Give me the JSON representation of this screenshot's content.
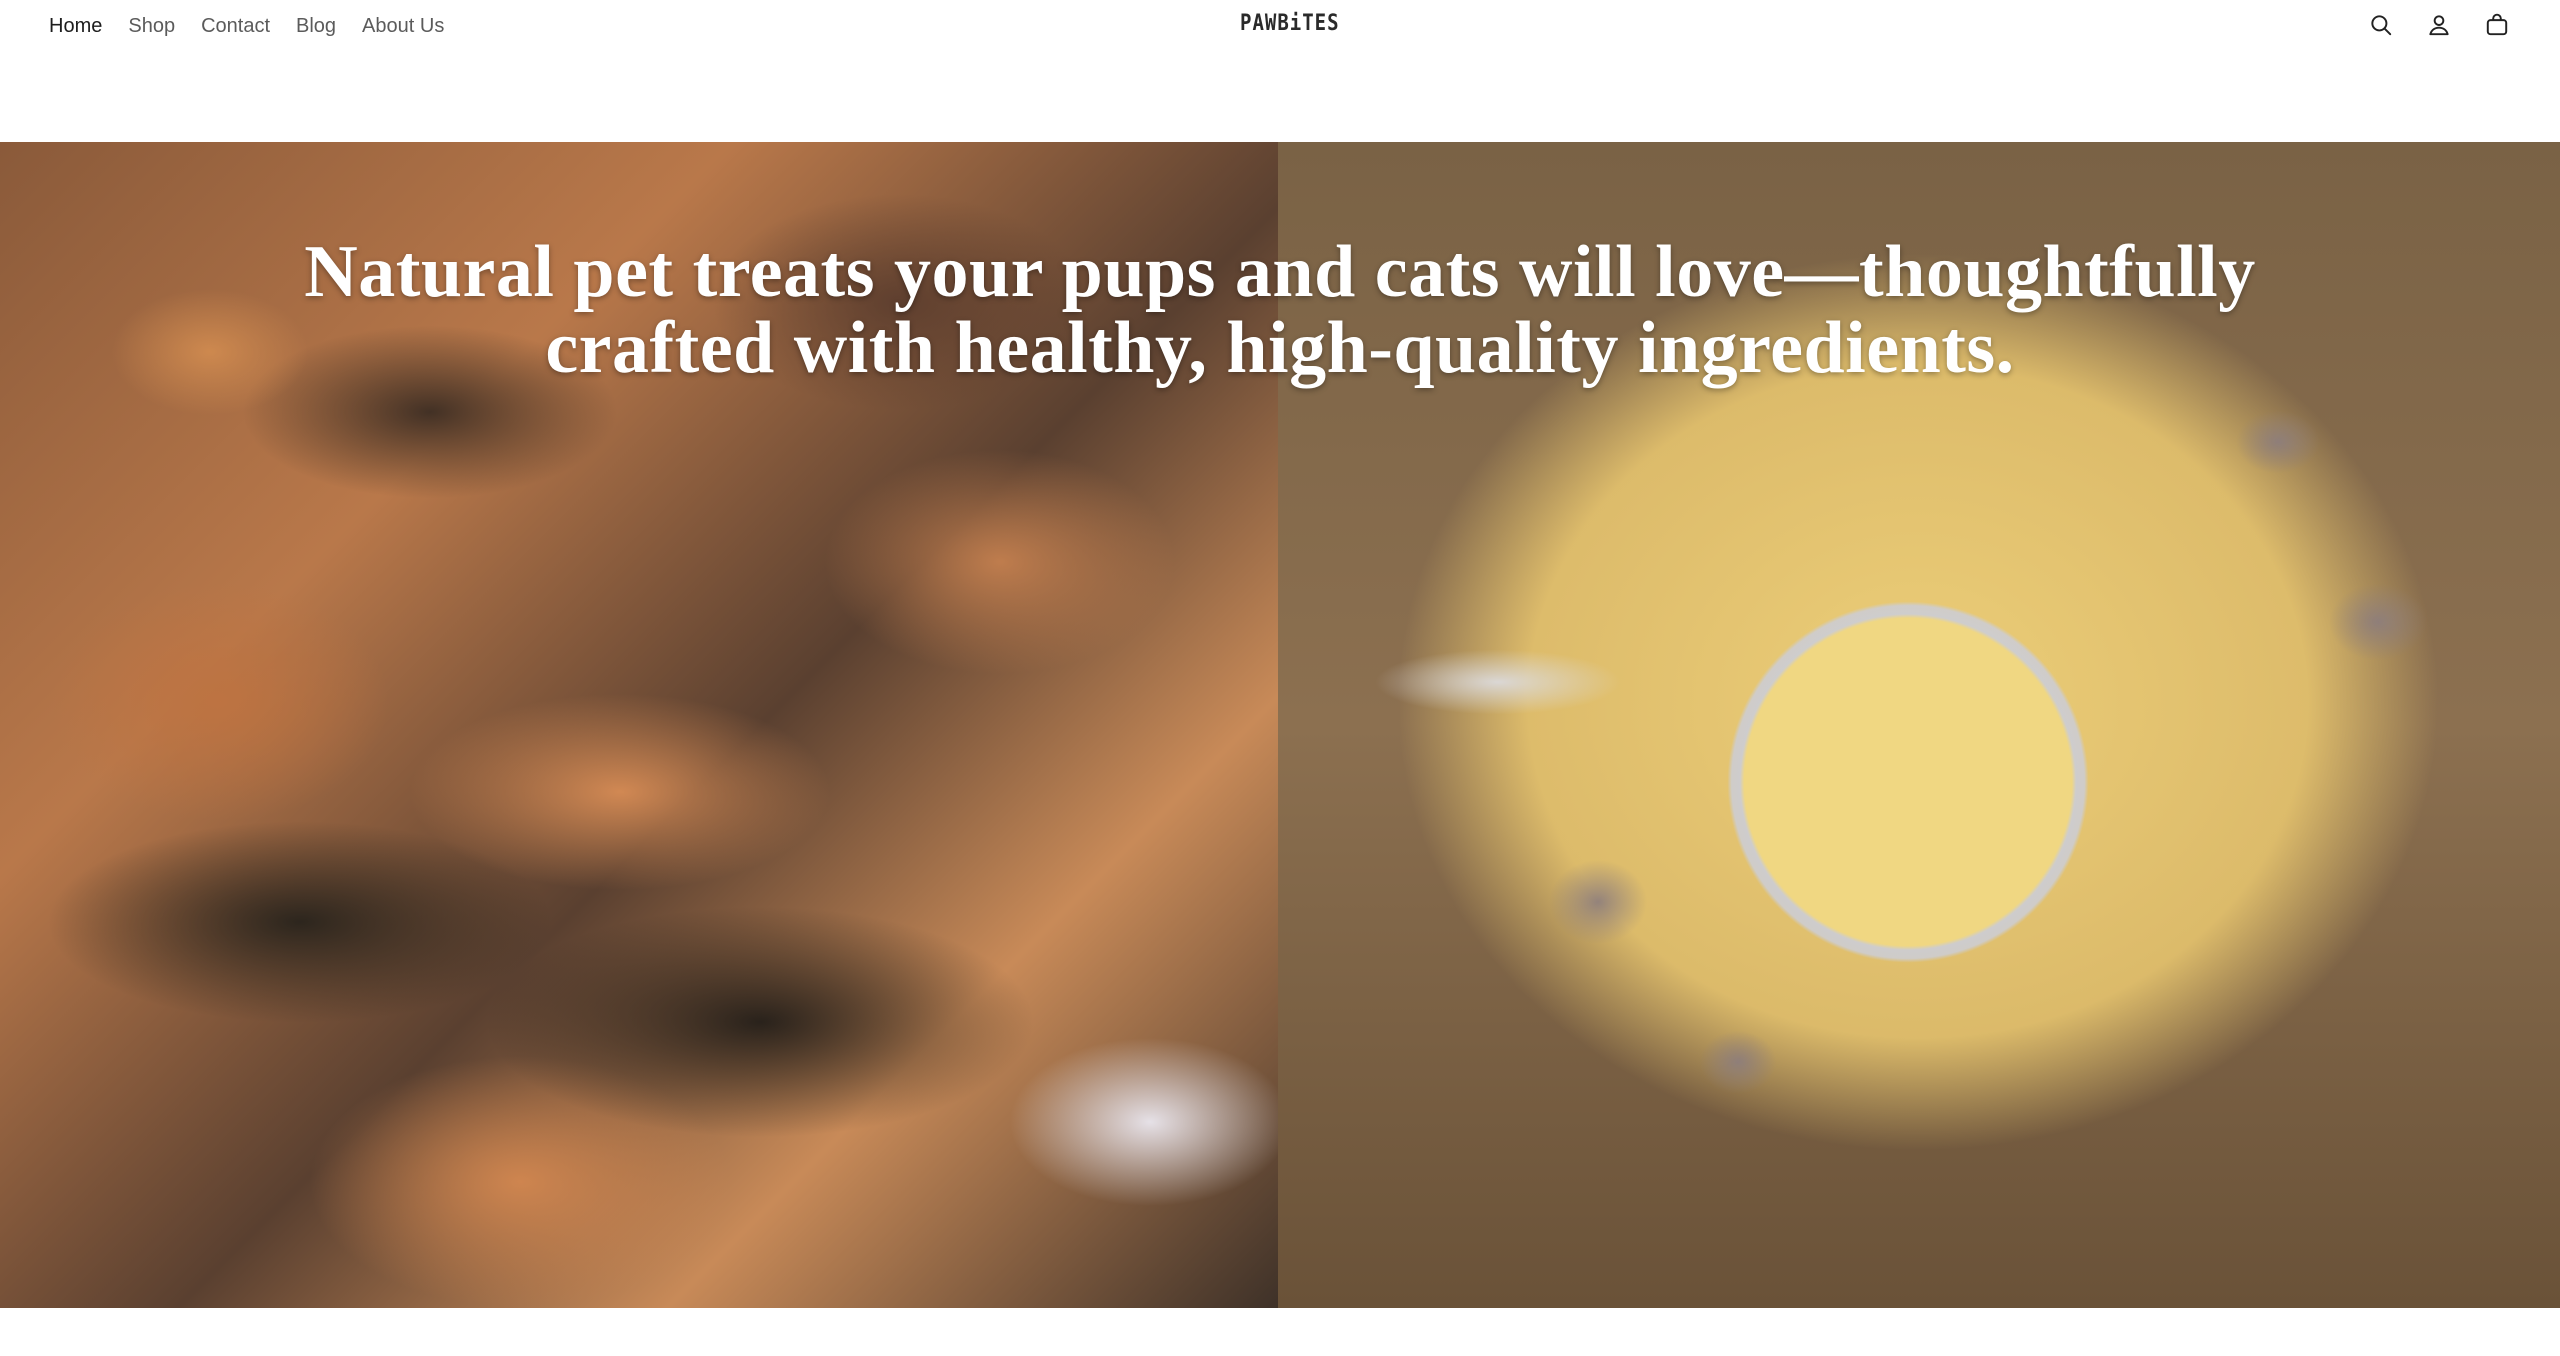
{
  "header": {
    "nav": [
      {
        "label": "Home",
        "active": true
      },
      {
        "label": "Shop",
        "active": false
      },
      {
        "label": "Contact",
        "active": false
      },
      {
        "label": "Blog",
        "active": false
      },
      {
        "label": "About Us",
        "active": false
      }
    ],
    "logo_text": "PAWBiTES",
    "icons": [
      "search-icon",
      "account-icon",
      "cart-icon"
    ]
  },
  "hero": {
    "title": "Natural pet treats your pups and cats will love—thoughtfully crafted with healthy, high-quality ingredients.",
    "left_image": "jerky-treats-image",
    "right_image": "powder-scoop-image"
  },
  "colors": {
    "nav_active": "#1d1d1d",
    "nav_inactive": "#5b5b5b",
    "hero_text": "#ffffff"
  }
}
